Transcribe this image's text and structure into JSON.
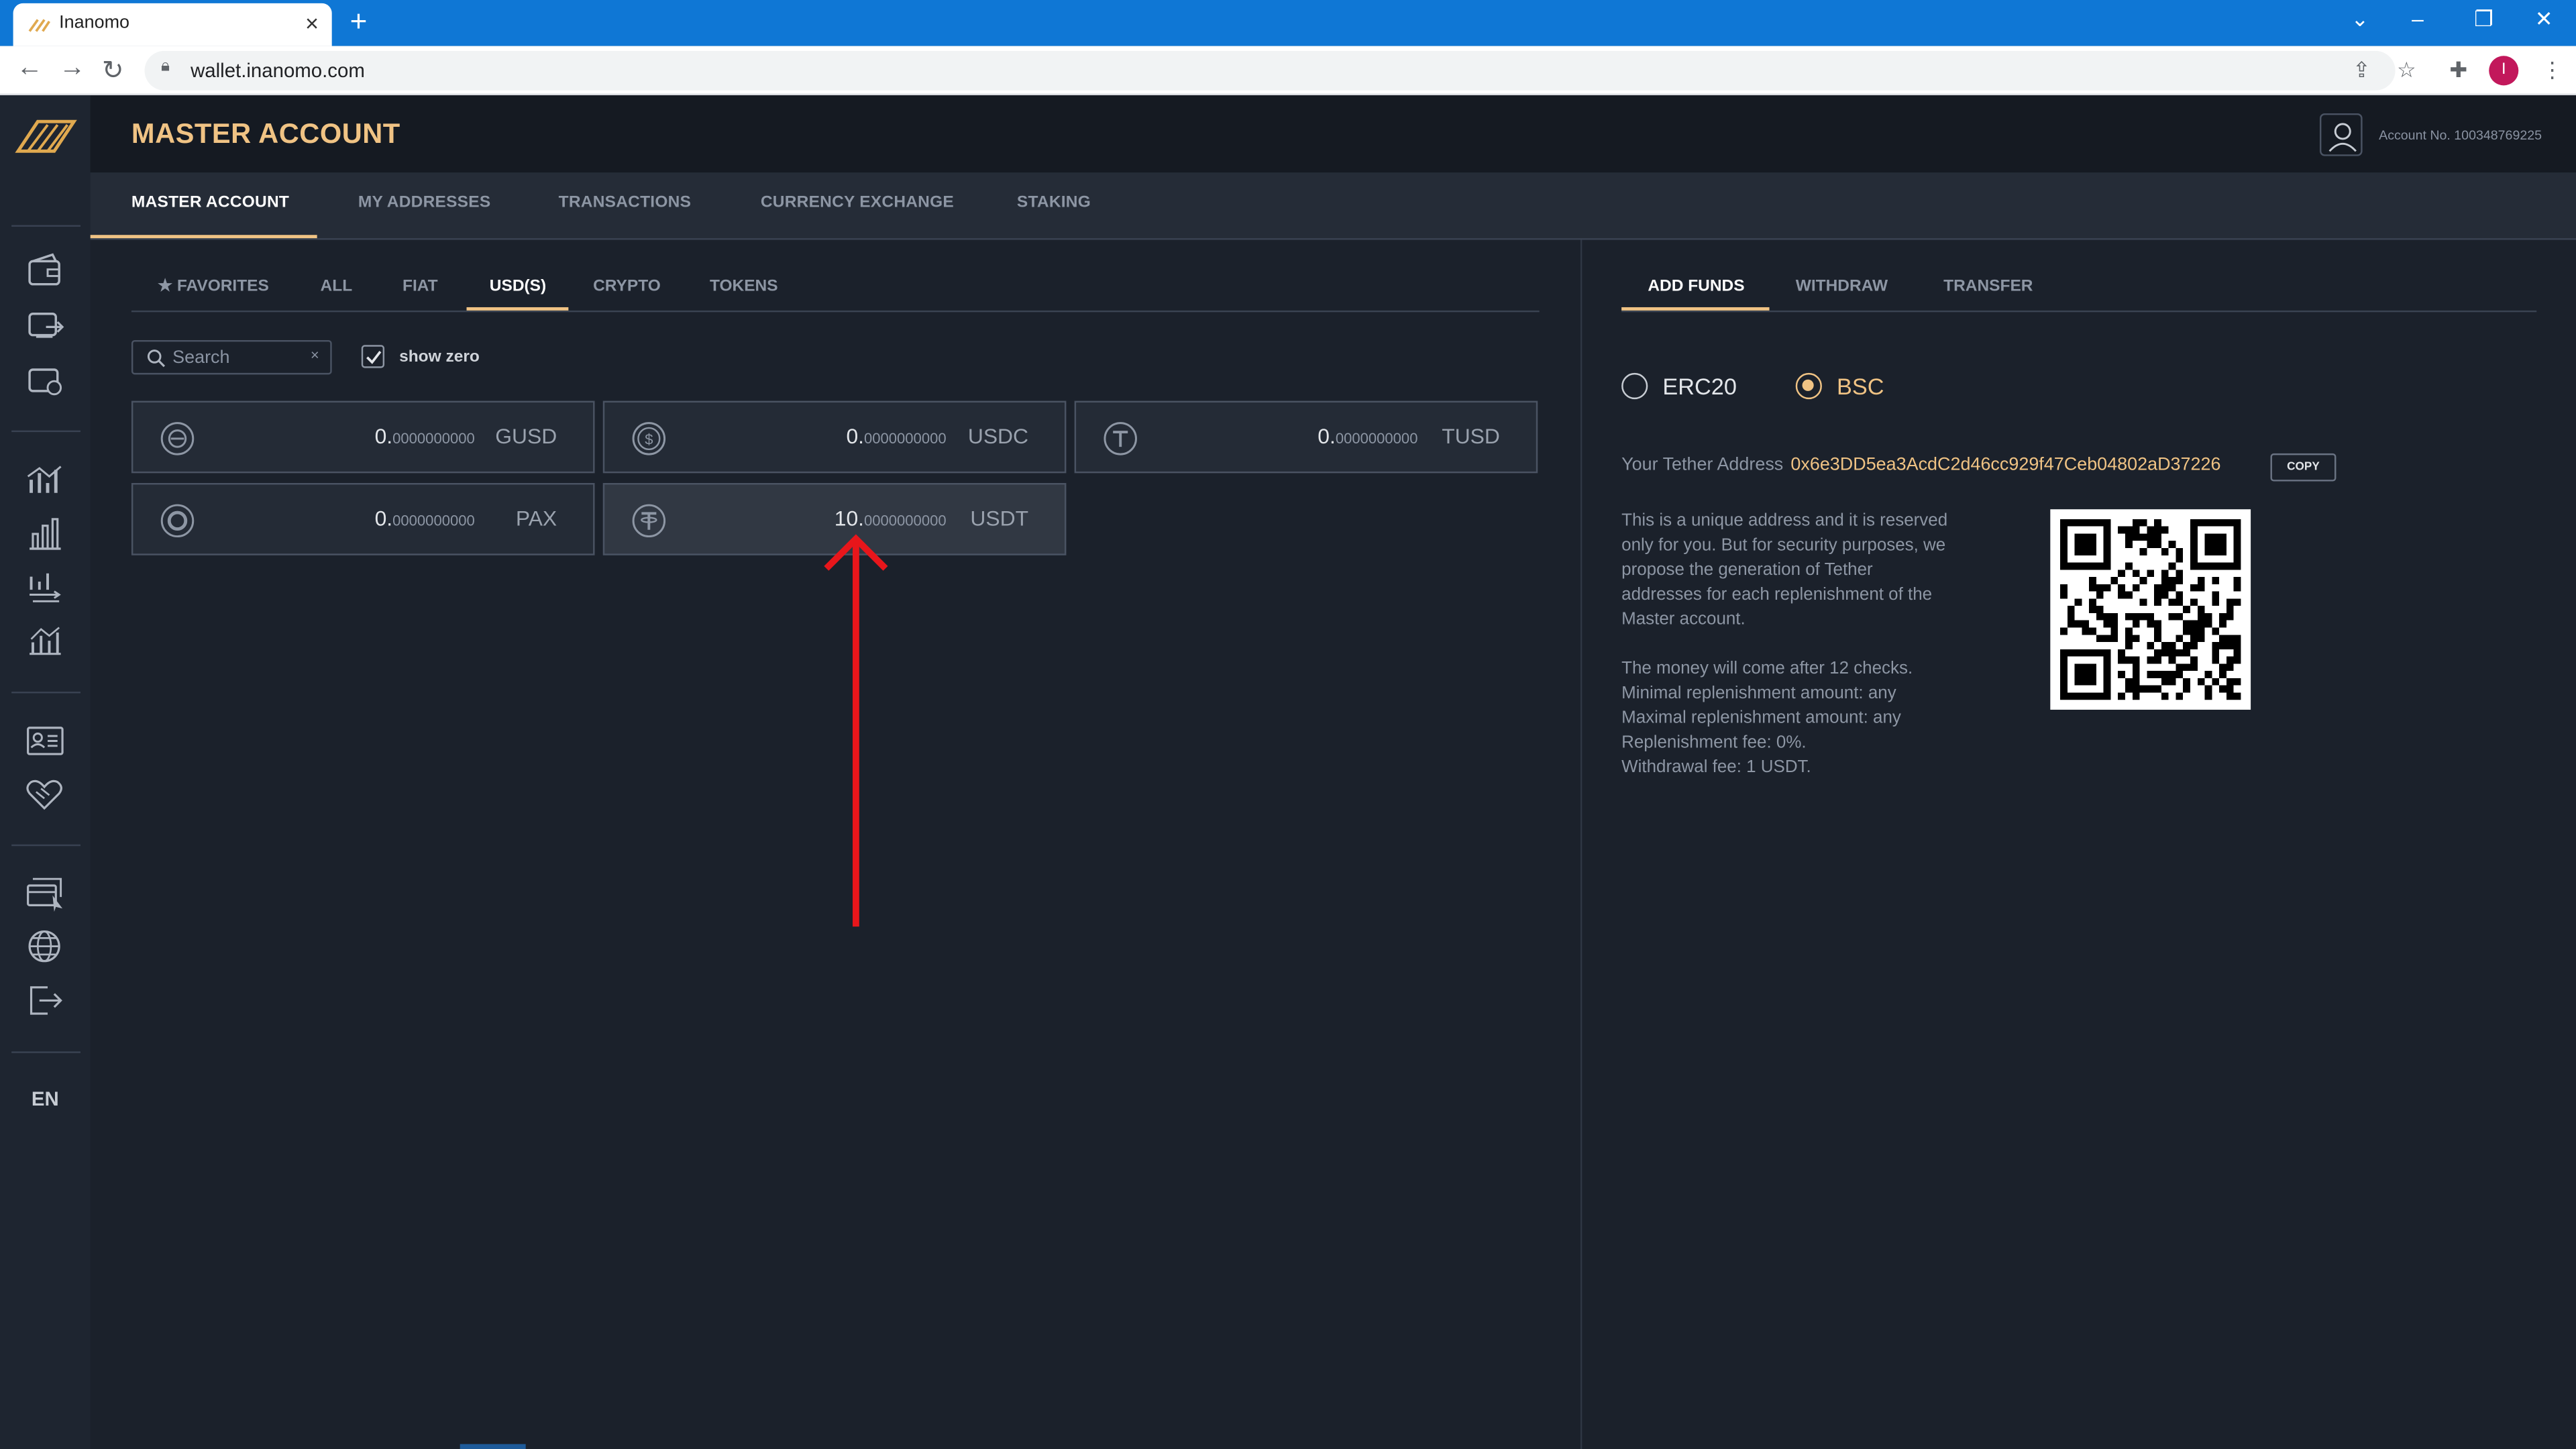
{
  "browser": {
    "tab_title": "Inanomo",
    "url": "wallet.inanomo.com",
    "profile_initial": "I"
  },
  "app": {
    "page_title": "MASTER ACCOUNT",
    "account_no": "Account No. 100348769225",
    "language": "EN",
    "accent_color": "#f0c384"
  },
  "main_nav": [
    "MASTER ACCOUNT",
    "MY ADDRESSES",
    "TRANSACTIONS",
    "CURRENCY EXCHANGE",
    "STAKING"
  ],
  "sub_tabs": [
    "FAVORITES",
    "ALL",
    "FIAT",
    "USD(S)",
    "CRYPTO",
    "TOKENS"
  ],
  "search": {
    "placeholder": "Search"
  },
  "show_zero_label": "show zero",
  "currencies": [
    {
      "code": "GUSD",
      "whole": "0.",
      "decimals": "0000000000",
      "icon": "gusd-coin-icon"
    },
    {
      "code": "USDC",
      "whole": "0.",
      "decimals": "0000000000",
      "icon": "usdc-coin-icon"
    },
    {
      "code": "TUSD",
      "whole": "0.",
      "decimals": "0000000000",
      "icon": "tusd-coin-icon"
    },
    {
      "code": "PAX",
      "whole": "0.",
      "decimals": "0000000000",
      "icon": "pax-coin-icon"
    },
    {
      "code": "USDT",
      "whole": "10.",
      "decimals": "0000000000",
      "icon": "usdt-coin-icon"
    }
  ],
  "funds": {
    "tabs": [
      "ADD FUNDS",
      "WITHDRAW",
      "TRANSFER"
    ],
    "networks": [
      "ERC20",
      "BSC"
    ],
    "selected_network": "BSC",
    "address_label": "Your Tether Address",
    "address": "0x6e3DD5ea3AcdC2d46cc929f47Ceb04802aD37226",
    "copy_label": "COPY",
    "info_lines_1": [
      "This is a unique address and it is reserved",
      "only for you. But for security purposes, we",
      "propose the generation of Tether",
      "addresses for each replenishment of the",
      "Master account."
    ],
    "info_lines_2": [
      "The money will come after 12 checks.",
      "Minimal replenishment amount: any",
      "Maximal replenishment amount: any",
      "Replenishment fee: 0%.",
      "Withdrawal fee: 1 USDT."
    ]
  }
}
